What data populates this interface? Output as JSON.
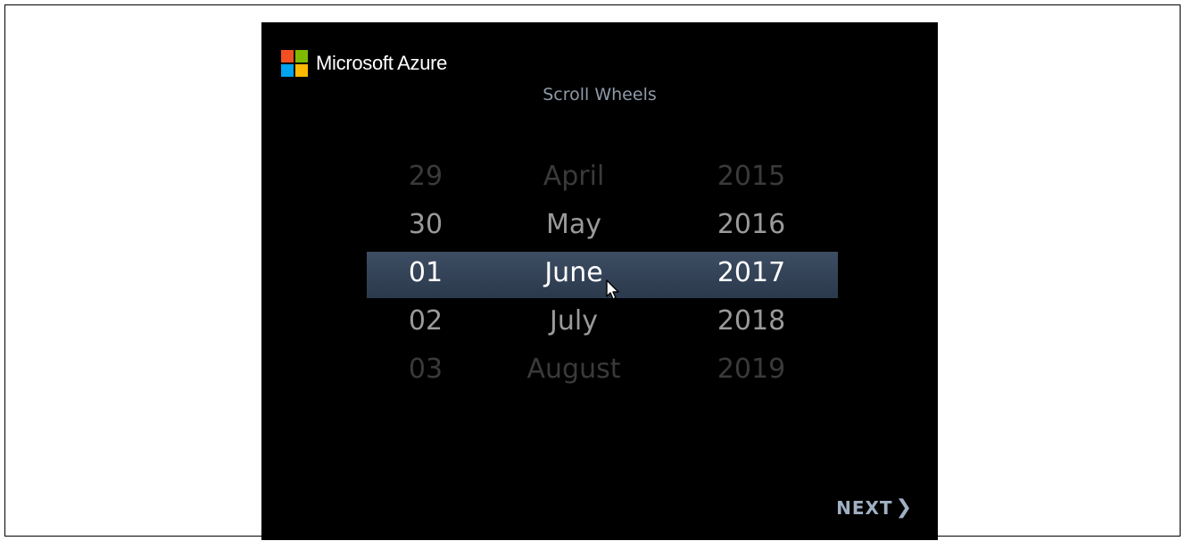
{
  "brand": {
    "name": "Microsoft Azure",
    "logo_colors": [
      "#f25022",
      "#7fba00",
      "#00a4ef",
      "#ffb900"
    ]
  },
  "screen": {
    "title": "Scroll Wheels"
  },
  "wheels": {
    "day": [
      "29",
      "30",
      "01",
      "02",
      "03"
    ],
    "month": [
      "April",
      "May",
      "June",
      "July",
      "August"
    ],
    "year": [
      "2015",
      "2016",
      "2017",
      "2018",
      "2019"
    ],
    "selected": {
      "day": "01",
      "month": "June",
      "year": "2017"
    },
    "selection_color": "#34445a"
  },
  "navigation": {
    "next_label": "NEXT",
    "next_icon": "chevron-right-icon"
  },
  "cursor": {
    "icon": "pointer-cursor-icon"
  }
}
